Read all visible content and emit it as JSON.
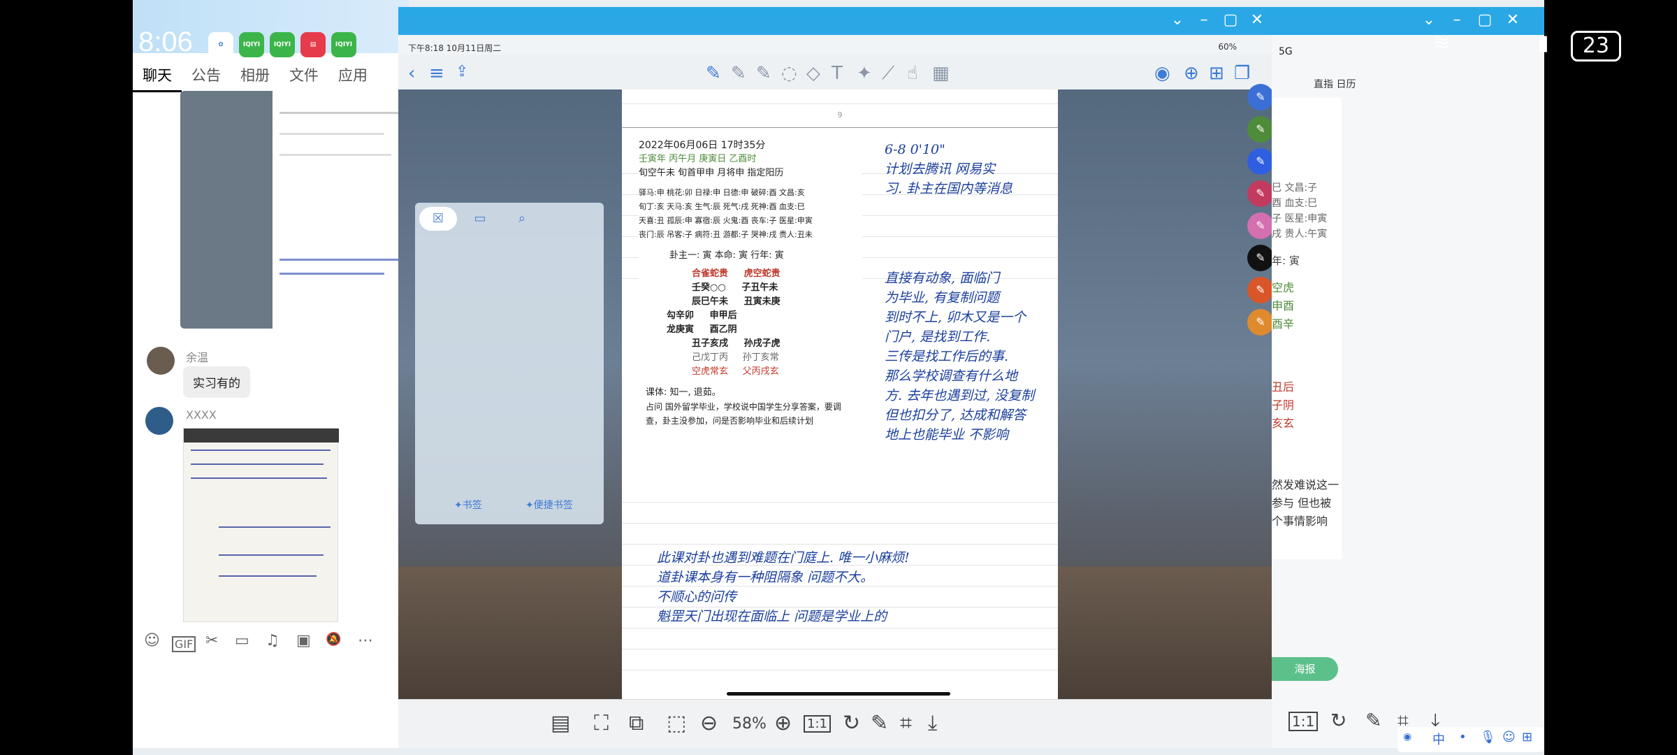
{
  "status": {
    "clock": "8:06",
    "battery_badge": "23"
  },
  "apps": [
    {
      "name": "app-icon-1",
      "color": "#3a7bd5",
      "label": ""
    },
    {
      "name": "app-icon-2",
      "color": "#3bb54a",
      "label": "IQIYI"
    },
    {
      "name": "app-icon-3",
      "color": "#3bb54a",
      "label": "IQIYI"
    },
    {
      "name": "app-icon-4",
      "color": "#e63b4a",
      "label": ""
    },
    {
      "name": "app-icon-5",
      "color": "#3bb54a",
      "label": "IQIYI"
    }
  ],
  "chat": {
    "tabs": [
      "聊天",
      "公告",
      "相册",
      "文件",
      "应用"
    ],
    "messages": [
      {
        "sender": "余温",
        "text": "实习有的"
      },
      {
        "sender": "XXXX",
        "text": ""
      }
    ],
    "tools": [
      "emoji-icon",
      "gif-icon",
      "scissors-icon",
      "folder-icon",
      "music-icon",
      "image-icon",
      "mute-icon",
      "more-icon"
    ],
    "tool_glyphs": [
      "☺",
      "GIF",
      "✂",
      "▭",
      "♫",
      "▣",
      "🔕",
      "⋯"
    ]
  },
  "tablet": {
    "status_left": "下午8:18  10月11日周二",
    "status_right": "60%",
    "page_number": "9",
    "chart": {
      "date": "2022年06月06日 17时35分",
      "pillars": "壬寅年 丙午月 庚寅日 乙酉时",
      "xunkong": "旬空午未 旬首甲申 月将申 指定阳历",
      "shensha": [
        "驿马:申  桃花:卯  日禄:申  日德:申  破碎:酉  文昌:亥",
        "旬丁:亥  天马:亥  生气:辰  死气:戌  死神:酉  血支:巳",
        "天喜:丑  孤辰:申  寡宿:辰  火鬼:酉  丧车:子  医星:申寅",
        "丧门:辰  吊客:子  病符:丑  游都:子  哭神:戌  贵人:丑未"
      ],
      "guazhu": "卦主一: 寅     本命: 寅     行年: 寅",
      "lines": [
        "合雀蛇贵     虎空蛇贵",
        "壬癸○○     子丑午未",
        "辰巳午未     丑寅未庚",
        "勾辛卯     申甲后",
        "龙庚寅     酉乙阴",
        "丑子亥戌     孙戌子虎",
        "己戊丁丙     孙丁亥常",
        "空虎常玄     父丙戌玄"
      ],
      "ketie": "课体: 知一, 退茹。",
      "question": "占问  国外留学毕业，学校说中国学生分享答案，要调查，卦主没参加，问是否影响毕业和后续计划"
    },
    "handwriting_right": [
      "6-8 0'10\"",
      "计划去腾讯 网易实",
      "习. 卦主在国内等消息",
      "直接有动象, 面临门",
      "为毕业, 有复制问题",
      "到时不上, 卯木又是一个",
      "门户, 是找到工作.",
      "三传是找工作后的事.",
      "那么学校调查有什么地",
      "方. 去年也遇到过, 没复制",
      "但也扣分了, 达成和解答",
      "地上也能毕业 不影响"
    ],
    "handwriting_bottom": [
      "此课对卦也遇到难题在门庭上. 唯一小麻烦!",
      "道卦课本身有一种阻隔象     问题不大。",
      "不顺心的问传",
      "魁罡天门出现在面临上 问题是学业上的"
    ],
    "side_panel": {
      "bookmark": "✦书签",
      "quick_bookmark": "✦便捷书签"
    },
    "pen_colors": [
      "#3b6fd6",
      "#4e8c3a",
      "#2f5fe0",
      "#c23a5e",
      "#d46fb0",
      "#111111",
      "#d9562a",
      "#e08a2e"
    ]
  },
  "viewer": {
    "zoom": "58%",
    "one_to_one": "1:1"
  },
  "right_window": {
    "signal": "5G",
    "tabs": "直指 日历",
    "lines": [
      "巳 文昌:子",
      "酉 血支:巳",
      "子 医星:申寅",
      "戌 贵人:午寅",
      "年: 寅",
      "空虎",
      "申酉",
      "酉辛",
      "丑后",
      "子阴",
      "亥玄"
    ],
    "text": [
      "然发难说这一",
      "参与 但也被",
      "个事情影响"
    ],
    "button": "海报",
    "one_to_one": "1:1"
  },
  "ime": {
    "label": "中"
  }
}
